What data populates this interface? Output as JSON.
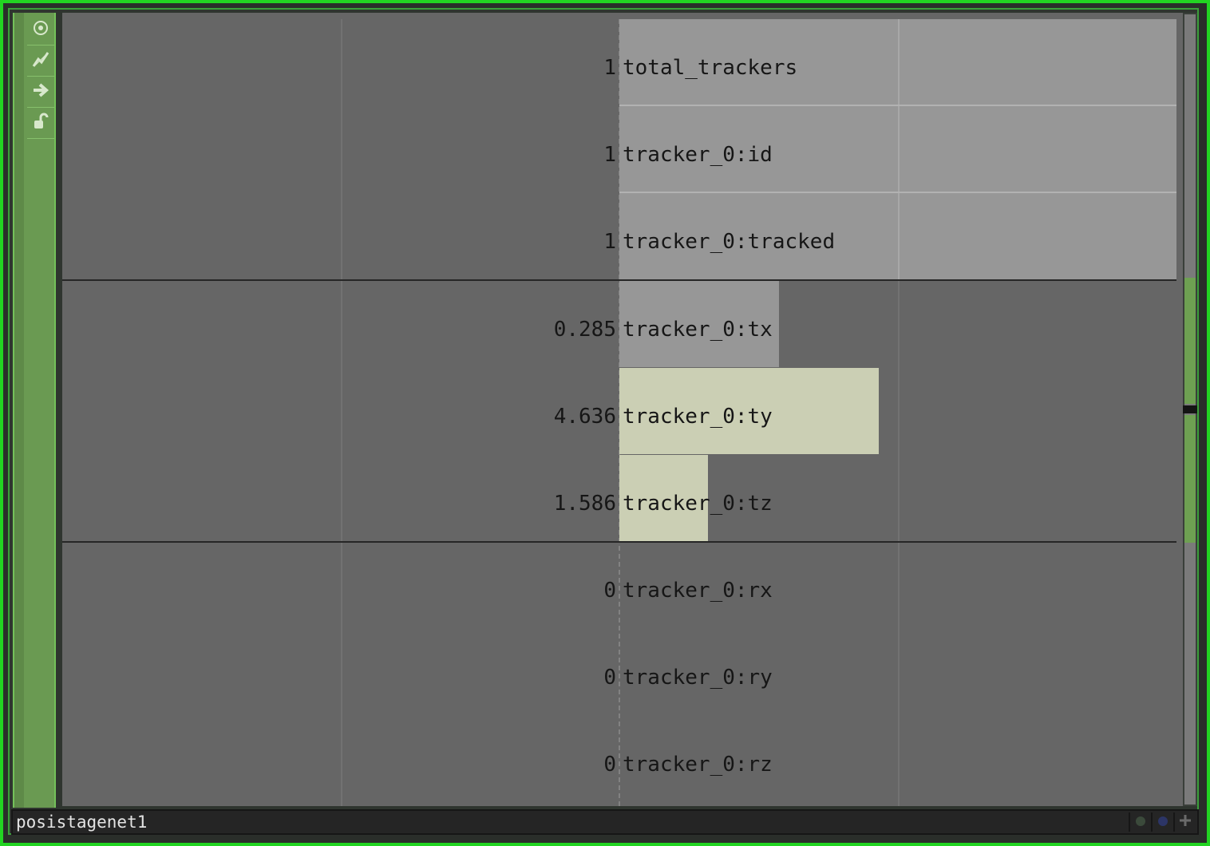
{
  "toolbar": {
    "items": [
      {
        "icon": "target-icon"
      },
      {
        "icon": "graph-icon"
      },
      {
        "icon": "arrow-right-icon"
      },
      {
        "icon": "unlock-icon"
      }
    ]
  },
  "channels": [
    {
      "value": "1",
      "name": "total_trackers"
    },
    {
      "value": "1",
      "name": "tracker_0:id"
    },
    {
      "value": "1",
      "name": "tracker_0:tracked"
    },
    {
      "value": "0.285",
      "name": "tracker_0:tx"
    },
    {
      "value": "4.636",
      "name": "tracker_0:ty"
    },
    {
      "value": "1.586",
      "name": "tracker_0:tz"
    },
    {
      "value": "0",
      "name": "tracker_0:rx"
    },
    {
      "value": "0",
      "name": "tracker_0:ry"
    },
    {
      "value": "0",
      "name": "tracker_0:rz"
    }
  ],
  "status": {
    "node_name": "posistagenet1"
  },
  "colors": {
    "frame": "#22d422",
    "toolbar": "#6a9a52",
    "viewer_bg": "#666666",
    "bar_gray": "#979797",
    "bar_active": "#cbcfb4"
  }
}
